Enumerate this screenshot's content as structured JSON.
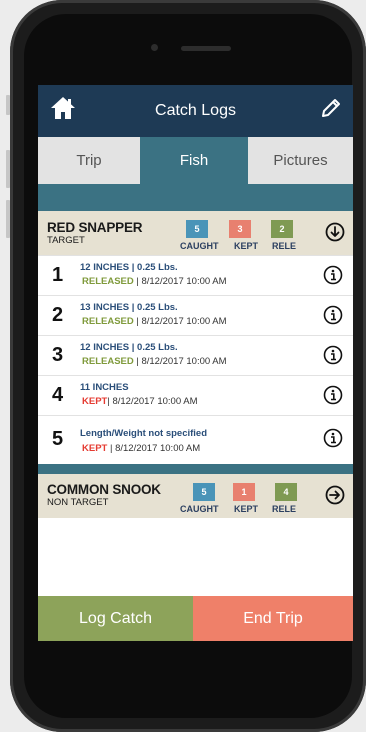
{
  "header": {
    "title": "Catch Logs"
  },
  "tabs": [
    {
      "label": "Trip"
    },
    {
      "label": "Fish"
    },
    {
      "label": "Pictures"
    }
  ],
  "groups": [
    {
      "name": "RED SNAPPER",
      "type": "TARGET",
      "caught": "5",
      "kept": "3",
      "released": "2",
      "caught_label": "CAUGHT",
      "kept_label": "KEPT",
      "released_label": "RELE"
    },
    {
      "name": "COMMON SNOOK",
      "type": "NON TARGET",
      "caught": "5",
      "kept": "1",
      "released": "4",
      "caught_label": "CAUGHT",
      "kept_label": "KEPT",
      "released_label": "RELE"
    }
  ],
  "catches": [
    {
      "num": "1",
      "size": "12 INCHES | 0.25 Lbs.",
      "status": "RELEASED",
      "date": " | 8/12/2017 10:00 AM"
    },
    {
      "num": "2",
      "size": "13 INCHES | 0.25 Lbs.",
      "status": "RELEASED",
      "date": " | 8/12/2017 10:00 AM"
    },
    {
      "num": "3",
      "size": "12 INCHES | 0.25 Lbs.",
      "status": "RELEASED",
      "date": " | 8/12/2017 10:00 AM"
    },
    {
      "num": "4",
      "size": "11 INCHES",
      "status": "KEPT",
      "date": "| 8/12/2017 10:00 AM"
    },
    {
      "num": "5",
      "size": "Length/Weight not specified",
      "status": "KEPT",
      "date": " | 8/12/2017 10:00 AM"
    }
  ],
  "footer": {
    "log_label": "Log Catch",
    "end_label": "End Trip"
  },
  "colors": {
    "header_bg": "#1e3a55",
    "tab_active": "#3b7283",
    "group_bg": "#e6e1d2",
    "caught": "#4a94b8",
    "kept": "#e8806f",
    "released": "#7f9a53",
    "log_catch": "#8da35a",
    "end_trip": "#ef8069"
  },
  "icons": [
    "home-icon",
    "pencil-icon",
    "arrow-down-circle-icon",
    "info-icon",
    "arrow-right-circle-icon"
  ]
}
